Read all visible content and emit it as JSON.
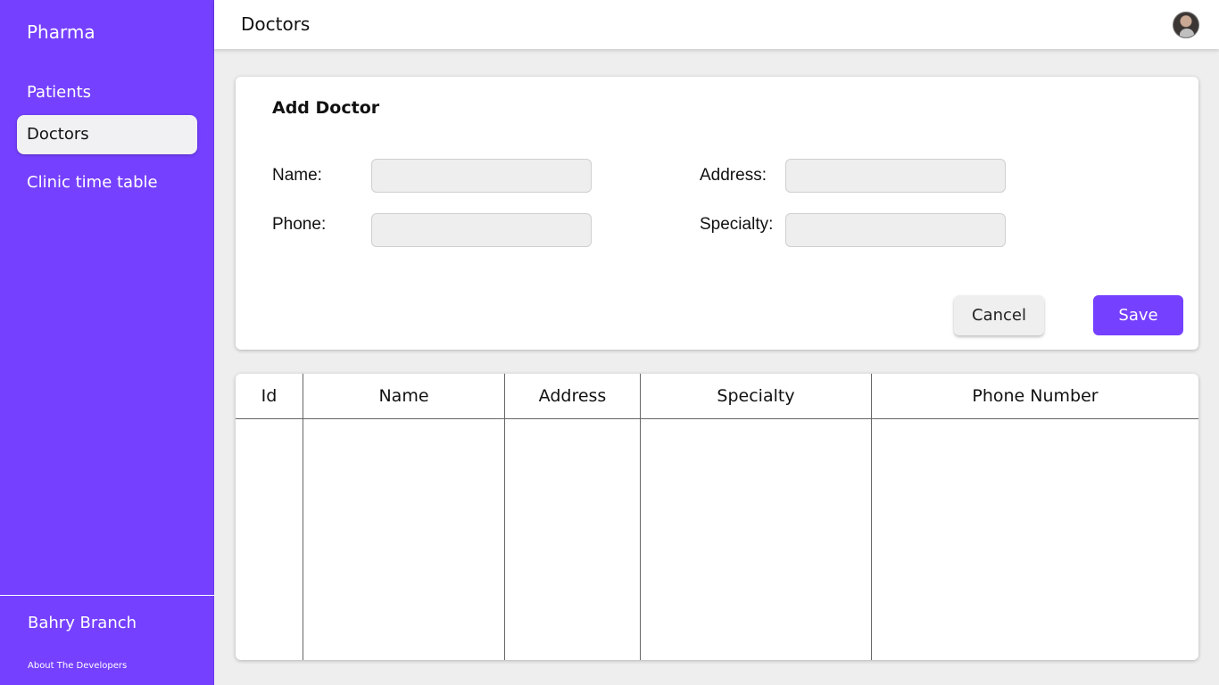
{
  "sidebar": {
    "brand": "Pharma",
    "items": [
      {
        "label": "Patients",
        "active": false
      },
      {
        "label": "Doctors",
        "active": true
      },
      {
        "label": "Clinic time table",
        "active": false
      }
    ],
    "branch": "Bahry Branch",
    "about_link": "About The Developers"
  },
  "header": {
    "title": "Doctors",
    "avatar_icon": "user-avatar"
  },
  "form": {
    "title": "Add Doctor",
    "fields": {
      "name": {
        "label": "Name:",
        "value": "",
        "placeholder": ""
      },
      "phone": {
        "label": "Phone:",
        "value": "",
        "placeholder": ""
      },
      "address": {
        "label": "Address:",
        "value": "",
        "placeholder": ""
      },
      "specialty": {
        "label": "Specialty:",
        "value": "",
        "placeholder": ""
      }
    },
    "cancel_label": "Cancel",
    "save_label": "Save"
  },
  "table": {
    "columns": [
      "Id",
      "Name",
      "Address",
      "Specialty",
      "Phone Number"
    ],
    "rows": []
  },
  "colors": {
    "accent": "#7540ff",
    "background": "#eeeeee",
    "card": "#ffffff"
  }
}
